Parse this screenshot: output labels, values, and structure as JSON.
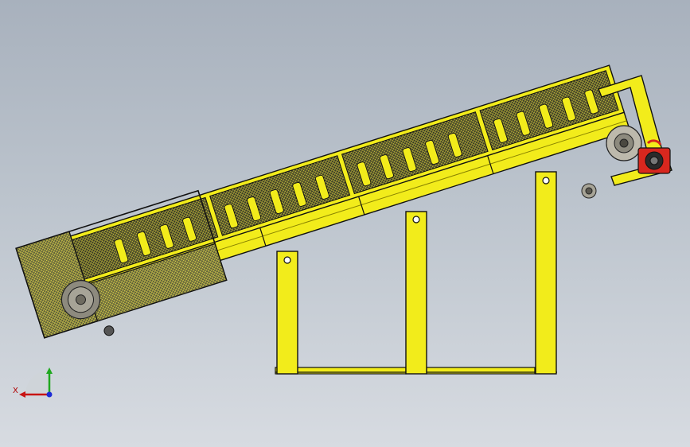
{
  "viewport": {
    "background_top": "#a8b1bd",
    "background_bottom": "#d7dbe1"
  },
  "model": {
    "colors": {
      "frame": "#f2ec1b",
      "frame_dark": "#8a8400",
      "belt_cover": "#3b3a2a",
      "outline": "#111111",
      "drive_unit": "#d8271e",
      "pulley": "#a7a497"
    }
  },
  "triad": {
    "x_label": "X",
    "x_color": "#c81414",
    "y_color": "#1fa81f",
    "z_color": "#1c2bd6",
    "icon": "coordinate-triad-icon"
  }
}
